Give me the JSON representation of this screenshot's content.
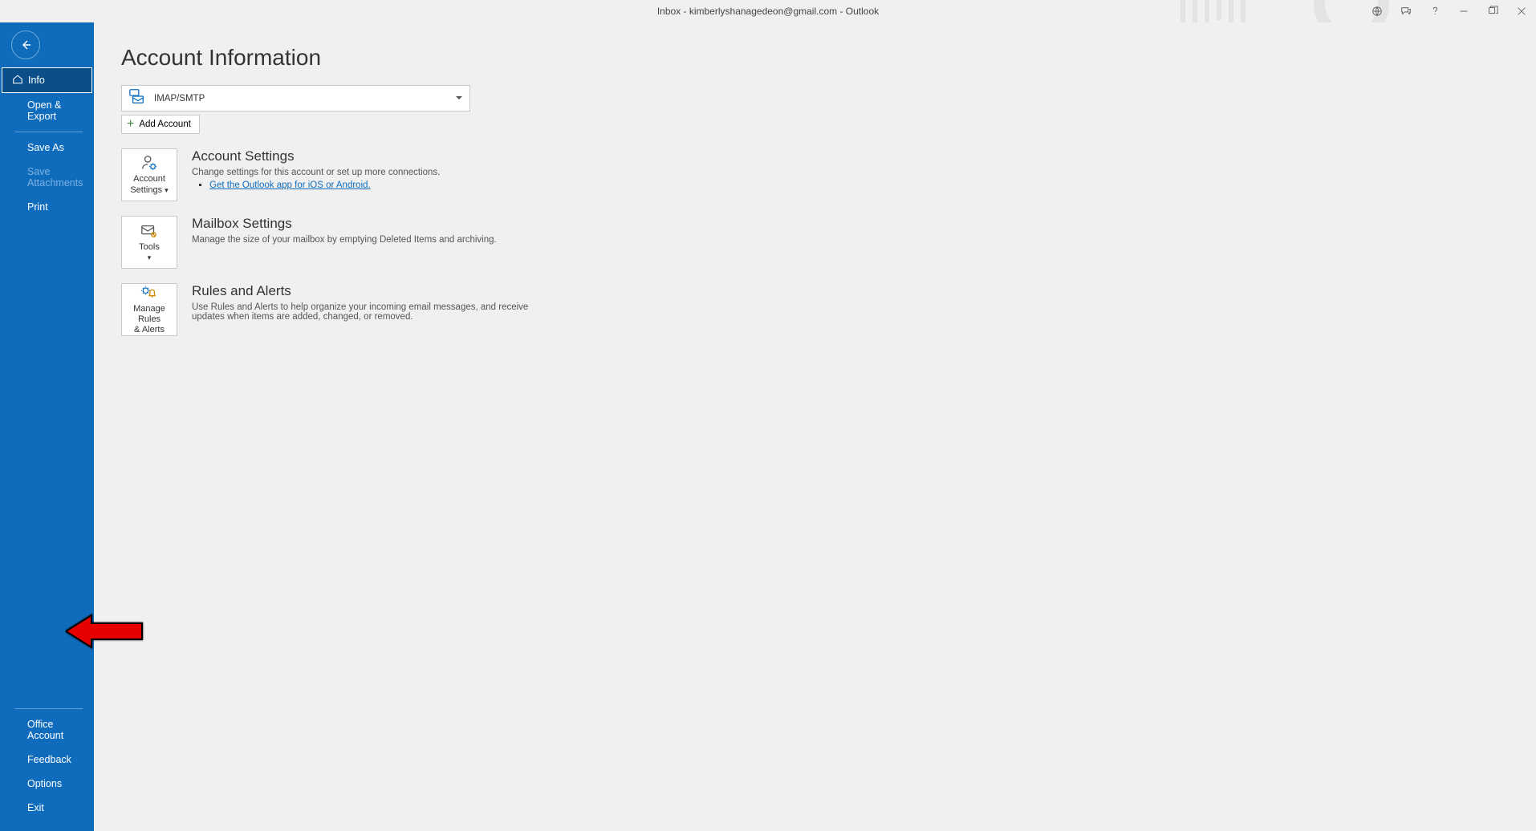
{
  "titlebar": {
    "title": "Inbox  -  kimberlyshanagedeon@gmail.com  -  Outlook"
  },
  "sidebar": {
    "items": {
      "info": "Info",
      "open_export": "Open & Export",
      "save_as": "Save As",
      "save_attachments": "Save Attachments",
      "print": "Print",
      "office_account": "Office Account",
      "feedback": "Feedback",
      "options": "Options",
      "exit": "Exit"
    }
  },
  "content": {
    "page_title": "Account Information",
    "account_dropdown": {
      "protocol": "IMAP/SMTP"
    },
    "add_account_label": "Add Account",
    "sections": {
      "account_settings": {
        "button_line1": "Account",
        "button_line2": "Settings",
        "title": "Account Settings",
        "desc": "Change settings for this account or set up more connections.",
        "link": "Get the Outlook app for iOS or Android."
      },
      "mailbox_settings": {
        "button_line1": "Tools",
        "title": "Mailbox Settings",
        "desc": "Manage the size of your mailbox by emptying Deleted Items and archiving."
      },
      "rules_alerts": {
        "button_line1": "Manage Rules",
        "button_line2": "& Alerts",
        "title": "Rules and Alerts",
        "desc": "Use Rules and Alerts to help organize your incoming email messages, and receive updates when items are added, changed, or removed."
      }
    }
  }
}
